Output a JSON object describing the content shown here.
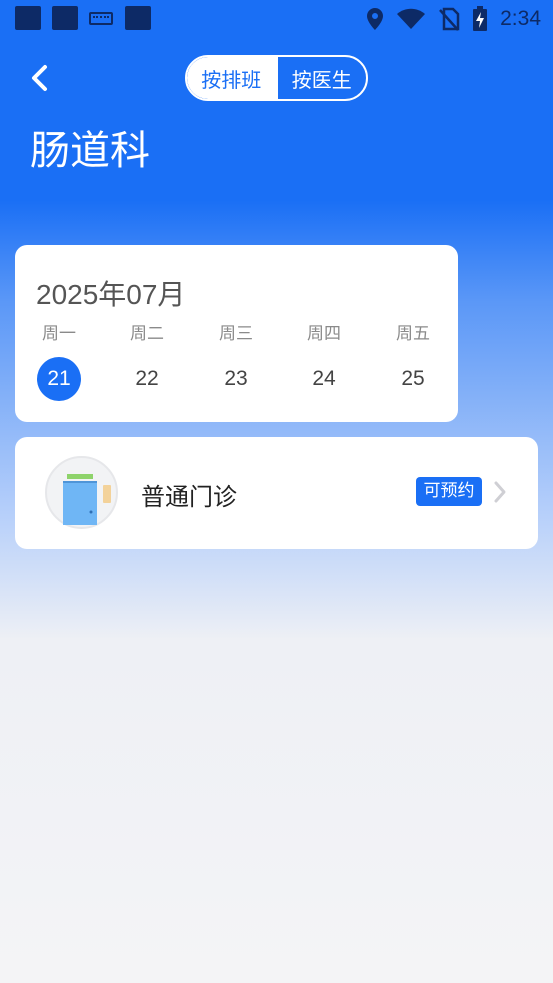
{
  "status_bar": {
    "time": "2:34",
    "icons": [
      "app-square-icon",
      "app-square-icon",
      "keyboard-icon",
      "app-square-icon",
      "location-icon",
      "wifi-icon",
      "no-sim-icon",
      "battery-charging-icon"
    ]
  },
  "header": {
    "toggle_schedule": "按排班",
    "toggle_doctor": "按医生",
    "title": "肠道科"
  },
  "calendar": {
    "month": "2025年07月",
    "days": [
      {
        "weekday": "周一",
        "day": "21",
        "selected": true
      },
      {
        "weekday": "周二",
        "day": "22",
        "selected": false
      },
      {
        "weekday": "周三",
        "day": "23",
        "selected": false
      },
      {
        "weekday": "周四",
        "day": "24",
        "selected": false
      },
      {
        "weekday": "周五",
        "day": "25",
        "selected": false
      }
    ]
  },
  "clinic": {
    "name": "普通门诊",
    "badge": "可预约",
    "icon": "door-icon"
  },
  "colors": {
    "primary": "#1a6ff5",
    "status_icons": "#0d2a66"
  }
}
